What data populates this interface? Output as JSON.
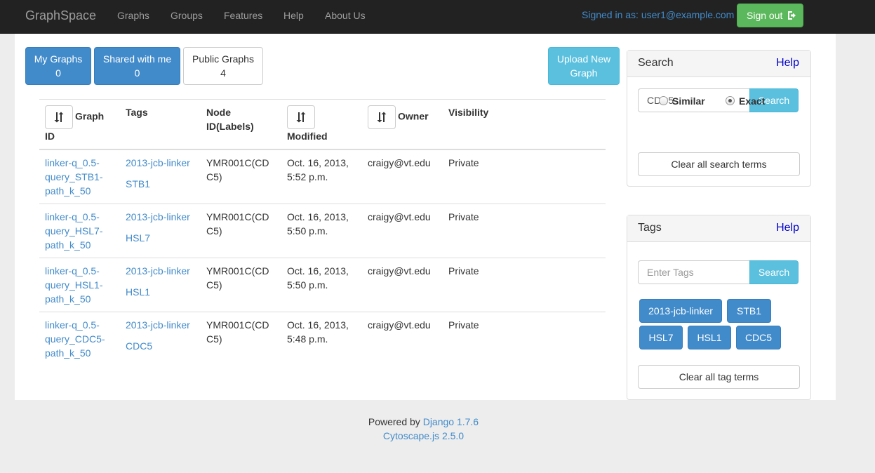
{
  "navbar": {
    "brand": "GraphSpace",
    "links": [
      "Graphs",
      "Groups",
      "Features",
      "Help",
      "About Us"
    ],
    "signed_in": "Signed in as: user1@example.com",
    "sign_out": "Sign out"
  },
  "categories": [
    {
      "label": "My Graphs",
      "count": "0"
    },
    {
      "label": "Shared with me",
      "count": "0"
    },
    {
      "label": "Public Graphs",
      "count": "4"
    }
  ],
  "upload": {
    "line1": "Upload New",
    "line2": "Graph"
  },
  "table": {
    "headers": [
      "Graph",
      "ID",
      "Tags",
      "Node",
      "ID(Labels)",
      "Modified",
      "Owner",
      "Visibility"
    ],
    "rows": [
      {
        "id": [
          "linker-q_0.5-",
          "query_STB1-",
          "path_k_50"
        ],
        "tags": [
          "2013-jcb-linker",
          "STB1"
        ],
        "node": [
          "YMR001C(CD",
          "C5)"
        ],
        "modified": [
          "Oct. 16, 2013,",
          "5:52 p.m."
        ],
        "owner": "craigy@vt.edu",
        "visibility": "Private"
      },
      {
        "id": [
          "linker-q_0.5-",
          "query_HSL7-",
          "path_k_50"
        ],
        "tags": [
          "2013-jcb-linker",
          "HSL7"
        ],
        "node": [
          "YMR001C(CD",
          "C5)"
        ],
        "modified": [
          "Oct. 16, 2013,",
          "5:50 p.m."
        ],
        "owner": "craigy@vt.edu",
        "visibility": "Private"
      },
      {
        "id": [
          "linker-q_0.5-",
          "query_HSL1-",
          "path_k_50"
        ],
        "tags": [
          "2013-jcb-linker",
          "HSL1"
        ],
        "node": [
          "YMR001C(CD",
          "C5)"
        ],
        "modified": [
          "Oct. 16, 2013,",
          "5:50 p.m."
        ],
        "owner": "craigy@vt.edu",
        "visibility": "Private"
      },
      {
        "id": [
          "linker-q_0.5-",
          "query_CDC5-",
          "path_k_50"
        ],
        "tags": [
          "2013-jcb-linker",
          "CDC5"
        ],
        "node": [
          "YMR001C(CD",
          "C5)"
        ],
        "modified": [
          "Oct. 16, 2013,",
          "5:48 p.m."
        ],
        "owner": "craigy@vt.edu",
        "visibility": "Private"
      }
    ]
  },
  "search_panel": {
    "title": "Search",
    "help": "Help",
    "value": "CDC5",
    "button": "Search",
    "similar": "Similar",
    "exact": "Exact",
    "selected": "Exact",
    "clear": "Clear all search terms"
  },
  "tags_panel": {
    "title": "Tags",
    "help": "Help",
    "placeholder": "Enter Tags",
    "button": "Search",
    "tags": [
      "2013-jcb-linker",
      "STB1",
      "HSL7",
      "HSL1",
      "CDC5"
    ],
    "clear": "Clear all tag terms"
  },
  "footer": {
    "powered": "Powered by",
    "django": "Django 1.7.6",
    "cytoscape": "Cytoscape.js 2.5.0"
  },
  "colors": {
    "primary": "#428bca",
    "info": "#5bc0de",
    "success": "#5cb85c",
    "navbar": "#222222"
  }
}
